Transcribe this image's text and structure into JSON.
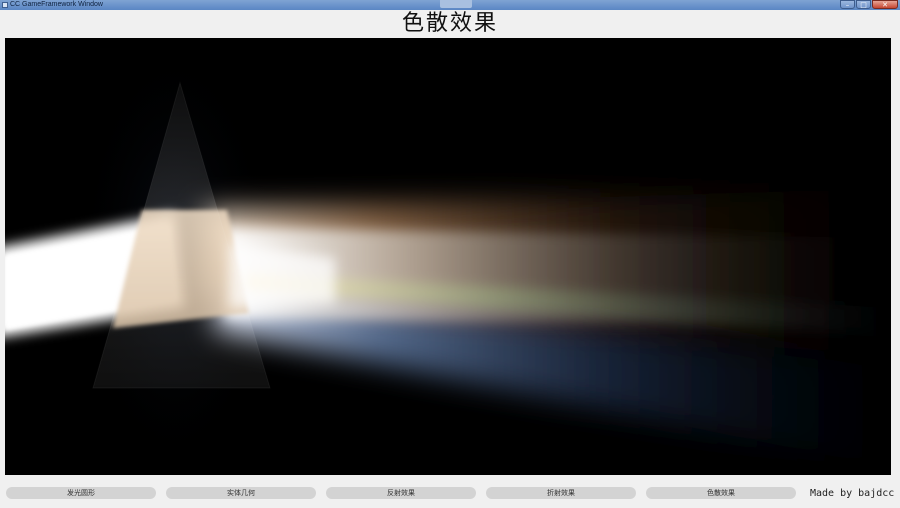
{
  "window": {
    "title": "CC GameFramework Window",
    "controls": {
      "minimize": "–",
      "maximize": "□",
      "close": "✕"
    }
  },
  "heading": "色散效果",
  "buttons": [
    {
      "label": "发光圆形"
    },
    {
      "label": "实体几何"
    },
    {
      "label": "反射效果"
    },
    {
      "label": "折射效果"
    },
    {
      "label": "色散效果"
    }
  ],
  "credit": "Made by bajdcc",
  "colors": {
    "titlebar": "#6b93cc",
    "canvas_bg": "#000000",
    "button_bg": "#d3d3d3",
    "page_bg": "#f0f0f0"
  }
}
